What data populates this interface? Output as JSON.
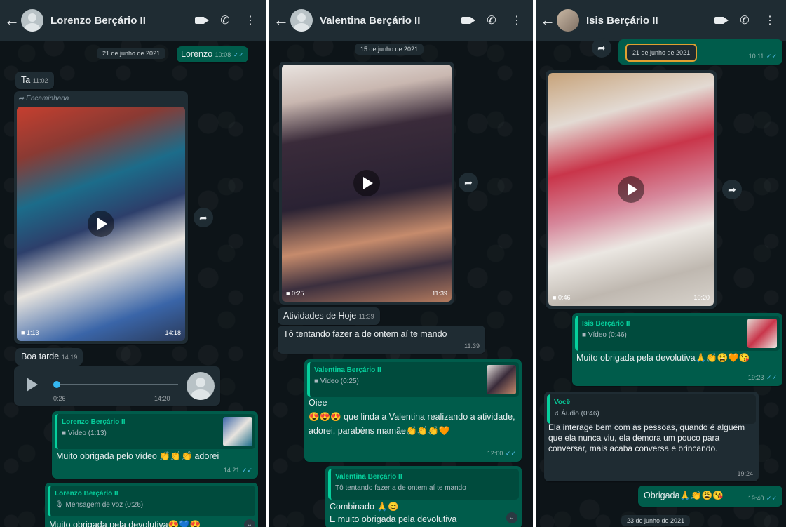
{
  "phone1": {
    "name": "Lorenzo Berçário II",
    "date": "21 de junho de 2021",
    "top_out_text": "Lorenzo",
    "top_out_time": "10:08",
    "ta_text": "Ta",
    "ta_time": "11:02",
    "forwarded": "Encaminhada",
    "video_duration": "1:13",
    "video_time": "14:18",
    "boa_tarde": "Boa tarde",
    "boa_tarde_time": "14:19",
    "audio_elapsed": "0:26",
    "audio_time": "14:20",
    "reply1_name": "Lorenzo Berçário II",
    "reply1_label": "Vídeo (1:13)",
    "reply1_text": "Muito obrigada pelo vídeo 👏👏👏 adorei",
    "reply1_time": "14:21",
    "reply2_name": "Lorenzo Berçário II",
    "reply2_label": "Mensagem de voz (0:26)",
    "reply2_text": "Muito obrigada pela devolutiva😍💙😍"
  },
  "phone2": {
    "name": "Valentina Berçário II",
    "date": "15 de junho de 2021",
    "video_duration": "0:25",
    "video_time": "11:39",
    "atividades": "Atividades de Hoje",
    "atividades_time": "11:39",
    "tentando": "Tô tentando fazer a de ontem aí te mando",
    "tentando_time": "11:39",
    "reply1_name": "Valentina Berçário II",
    "reply1_label": "Vídeo (0:25)",
    "reply1_text1": "Oiee",
    "reply1_text2": "😍😍😍 que linda a Valentina realizando a atividade, adorei, parabéns mamãe👏👏👏🧡",
    "reply1_time": "12:00",
    "reply2_name": "Valentina Berçário II",
    "reply2_quote": "Tô tentando fazer a de ontem aí te mando",
    "reply2_text1": "Combinado 🙏😊",
    "reply2_text2": "E muito obrigada pela devolutiva"
  },
  "phone3": {
    "name": "Isis Berçário II",
    "top_date": "21 de junho de 2021",
    "top_time": "10:11",
    "video_duration": "0:46",
    "video_time": "10:20",
    "reply1_name": "Isis Berçário II",
    "reply1_label": "Vídeo (0:46)",
    "reply1_text": "Muito obrigada pela devolutiva🙏👏😩🧡😘",
    "reply1_time": "19:23",
    "you_label": "Você",
    "audio_label": "Áudio (0:46)",
    "long_text": "Ela interage bem com as pessoas, quando é alguém que ela nunca viu, ela demora um pouco para conversar, mais acaba conversa e brincando.",
    "long_time": "19:24",
    "obrigada": "Obrigada🙏👏😩😘",
    "obrigada_time": "19:40",
    "bottom_date": "23 de junho de 2021"
  }
}
